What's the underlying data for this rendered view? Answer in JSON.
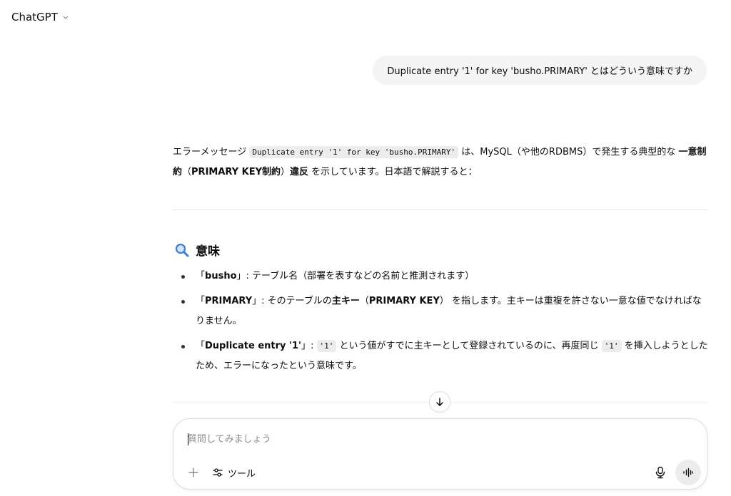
{
  "header": {
    "model_name": "ChatGPT"
  },
  "user_message": "Duplicate entry '1' for key 'busho.PRIMARY' とはどういう意味ですか",
  "assistant": {
    "intro": {
      "t1": "エラーメッセージ ",
      "code": "Duplicate entry '1' for key 'busho.PRIMARY'",
      "t2": " は、MySQL（や他のRDBMS）で発生する典型的な ",
      "bold1": "一意制約",
      "t3": "（",
      "bold2": "PRIMARY KEY制約",
      "t4": "）",
      "bold3": "違反",
      "t5": " を示しています。日本語で解説すると："
    },
    "section_title": "意味",
    "items": [
      {
        "open": "「",
        "bold": "busho",
        "close": "」: テーブル名（部署を表すなどの名前と推測されます）"
      },
      {
        "open": "「",
        "bold": "PRIMARY",
        "close": "」: そのテーブルの",
        "bold2": "主キー",
        "t2": "（",
        "bold3": "PRIMARY KEY",
        "t3": "） を指します。主キーは重複を許さない一意な値でなければなりません。"
      },
      {
        "open": "「",
        "bold": "Duplicate entry '1'",
        "close": "」: ",
        "code1": "'1'",
        "t2": " という値がすでに主キーとして登録されているのに、再度同じ ",
        "code2": "'1'",
        "t3": " を挿入しようとしたため、エラーになったという意味です。"
      }
    ]
  },
  "composer": {
    "placeholder": "質問してみましょう",
    "value": "",
    "tools_label": "ツール"
  },
  "icons": {
    "chevron": "chevron-down-icon",
    "search": "magnifier-icon",
    "scroll": "arrow-down-icon",
    "plus": "plus-icon",
    "tools": "sliders-icon",
    "mic": "microphone-icon",
    "voice": "voice-mode-icon"
  }
}
